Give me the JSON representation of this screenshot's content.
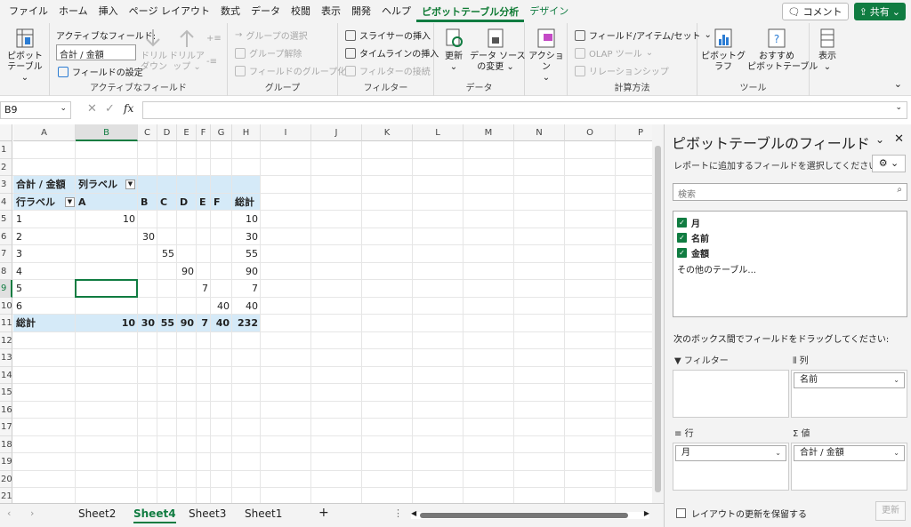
{
  "menu": {
    "tabs": [
      "ファイル",
      "ホーム",
      "挿入",
      "ページ レイアウト",
      "数式",
      "データ",
      "校閲",
      "表示",
      "開発",
      "ヘルプ",
      "ピボットテーブル分析",
      "デザイン"
    ],
    "active_tab": "ピボットテーブル分析",
    "comment_label": "コメント",
    "share_label": "共有"
  },
  "ribbon": {
    "pivot_table_label": "ピボットテーブル",
    "active_field_label": "アクティブなフィールド:",
    "active_field_value": "合計 / 金額",
    "field_settings_label": "フィールドの設定",
    "drilldown_label": "ドリル\nダウン",
    "drillup_label": "ドリルアップ",
    "group_active_field": "アクティブなフィールド",
    "group_selection": "グループの選択",
    "ungroup": "グループ解除",
    "group_field": "フィールドのグループ化",
    "group_group": "グループ",
    "insert_slicer": "スライサーの挿入",
    "insert_timeline": "タイムラインの挿入",
    "filter_connections": "フィルターの接続",
    "group_filter": "フィルター",
    "refresh_label": "更新",
    "change_source_label": "データ ソース\nの変更",
    "group_data": "データ",
    "actions_label": "アクション",
    "fields_items_sets": "フィールド/アイテム/セット",
    "olap_tools": "OLAP ツール",
    "relationships": "リレーションシップ",
    "group_calculations": "計算方法",
    "pivot_chart": "ピボットグラフ",
    "recommended_pivot": "おすすめ\nピボットテーブル",
    "group_tools": "ツール",
    "show_label": "表示"
  },
  "formula": {
    "name_box": "B9",
    "fx": "fx",
    "content": ""
  },
  "columns": [
    "A",
    "B",
    "C",
    "D",
    "E",
    "F",
    "G",
    "H",
    "I",
    "J",
    "K",
    "L",
    "M",
    "N",
    "O",
    "P"
  ],
  "rows": [
    "1",
    "2",
    "3",
    "4",
    "5",
    "6",
    "7",
    "8",
    "9",
    "10",
    "11",
    "12",
    "13",
    "14",
    "15",
    "16",
    "17",
    "18",
    "19",
    "20",
    "21"
  ],
  "pivot": {
    "corner": "合計 / 金額",
    "col_labels": "列ラベル",
    "row_labels": "行ラベル",
    "headers": [
      "A",
      "B",
      "C",
      "D",
      "E",
      "F",
      "総計"
    ],
    "data_rows": [
      {
        "label": "1",
        "values": [
          "10",
          "",
          "",
          "",
          "",
          "",
          "10"
        ]
      },
      {
        "label": "2",
        "values": [
          "",
          "30",
          "",
          "",
          "",
          "",
          "30"
        ]
      },
      {
        "label": "3",
        "values": [
          "",
          "",
          "55",
          "",
          "",
          "",
          "55"
        ]
      },
      {
        "label": "4",
        "values": [
          "",
          "",
          "",
          "90",
          "",
          "",
          "90"
        ]
      },
      {
        "label": "5",
        "values": [
          "",
          "",
          "",
          "",
          "7",
          "",
          "7"
        ]
      },
      {
        "label": "6",
        "values": [
          "",
          "",
          "",
          "",
          "",
          "40",
          "40"
        ]
      }
    ],
    "total_label": "総計",
    "totals": [
      "10",
      "30",
      "55",
      "90",
      "7",
      "40",
      "232"
    ]
  },
  "sheets": {
    "tabs": [
      "Sheet2",
      "Sheet4",
      "Sheet3",
      "Sheet1"
    ],
    "active": "Sheet4",
    "add": "+"
  },
  "pane": {
    "title": "ピボットテーブルのフィールド",
    "subtitle": "レポートに追加するフィールドを選択してください:",
    "search_placeholder": "検索",
    "fields": [
      "月",
      "名前",
      "金額"
    ],
    "more_tables": "その他のテーブル...",
    "drag_hint": "次のボックス間でフィールドをドラッグしてください:",
    "filter_area": "フィルター",
    "column_area": "列",
    "row_area": "行",
    "values_area": "値",
    "column_field": "名前",
    "row_field": "月",
    "values_field": "合計 / 金額",
    "defer_label": "レイアウトの更新を保留する",
    "update_label": "更新"
  }
}
